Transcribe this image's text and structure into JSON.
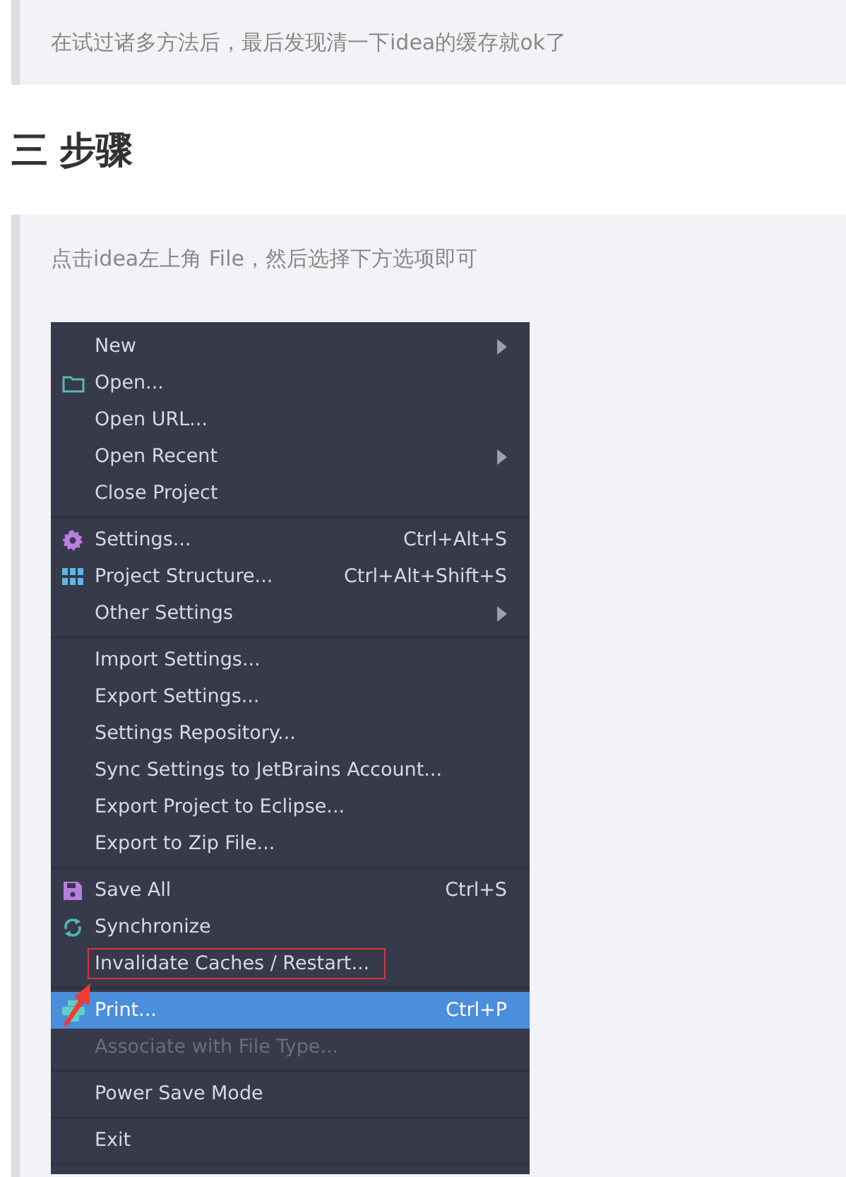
{
  "notes": [
    {
      "text": "在试过诸多方法后，最后发现清一下idea的缓存就ok了"
    }
  ],
  "heading": {
    "number": "三",
    "title": "步骤"
  },
  "step": {
    "text": "点击idea左上角 File，然后选择下方选项即可",
    "menu": {
      "groups": [
        [
          {
            "kind": "plain",
            "label": "New",
            "submenu": true,
            "selected": false,
            "disabled": false,
            "boxed": false
          },
          {
            "kind": "folder",
            "label": "Open...",
            "submenu": false,
            "selected": false,
            "disabled": false,
            "boxed": false
          },
          {
            "kind": "plain",
            "label": "Open URL...",
            "submenu": false,
            "selected": false,
            "disabled": false,
            "boxed": false
          },
          {
            "kind": "plain",
            "label": "Open Recent",
            "submenu": true,
            "selected": false,
            "disabled": false,
            "boxed": false
          },
          {
            "kind": "plain",
            "label": "Close Project",
            "submenu": false,
            "selected": false,
            "disabled": false,
            "boxed": false
          }
        ],
        [
          {
            "kind": "gear",
            "label": "Settings...",
            "shortcut": "Ctrl+Alt+S",
            "submenu": false,
            "selected": false,
            "disabled": false,
            "boxed": false
          },
          {
            "kind": "grid",
            "label": "Project Structure...",
            "shortcut": "Ctrl+Alt+Shift+S",
            "submenu": false,
            "selected": false,
            "disabled": false,
            "boxed": false
          },
          {
            "kind": "plain",
            "label": "Other Settings",
            "submenu": true,
            "selected": false,
            "disabled": false,
            "boxed": false
          }
        ],
        [
          {
            "kind": "plain",
            "label": "Import Settings...",
            "submenu": false,
            "selected": false,
            "disabled": false,
            "boxed": false
          },
          {
            "kind": "plain",
            "label": "Export Settings...",
            "submenu": false,
            "selected": false,
            "disabled": false,
            "boxed": false
          },
          {
            "kind": "plain",
            "label": "Settings Repository...",
            "submenu": false,
            "selected": false,
            "disabled": false,
            "boxed": false
          },
          {
            "kind": "plain",
            "label": "Sync Settings to JetBrains Account...",
            "submenu": false,
            "selected": false,
            "disabled": false,
            "boxed": false
          },
          {
            "kind": "plain",
            "label": "Export Project to Eclipse...",
            "submenu": false,
            "selected": false,
            "disabled": false,
            "boxed": false
          },
          {
            "kind": "plain",
            "label": "Export to Zip File...",
            "submenu": false,
            "selected": false,
            "disabled": false,
            "boxed": false
          }
        ],
        [
          {
            "kind": "save",
            "label": "Save All",
            "shortcut": "Ctrl+S",
            "submenu": false,
            "selected": false,
            "disabled": false,
            "boxed": false
          },
          {
            "kind": "sync",
            "label": "Synchronize",
            "submenu": false,
            "selected": false,
            "disabled": false,
            "boxed": false
          },
          {
            "kind": "plain",
            "label": "Invalidate Caches / Restart...",
            "submenu": false,
            "selected": false,
            "disabled": false,
            "boxed": true
          }
        ],
        [
          {
            "kind": "print",
            "label": "Print...",
            "shortcut": "Ctrl+P",
            "submenu": false,
            "selected": true,
            "disabled": false,
            "boxed": false
          },
          {
            "kind": "plain",
            "label": "Associate with File Type...",
            "submenu": false,
            "selected": false,
            "disabled": true,
            "boxed": false
          }
        ],
        [
          {
            "kind": "plain",
            "label": "Power Save Mode",
            "submenu": false,
            "selected": false,
            "disabled": false,
            "boxed": false
          }
        ],
        [
          {
            "kind": "plain",
            "label": "Exit",
            "submenu": false,
            "selected": false,
            "disabled": false,
            "boxed": false
          }
        ]
      ]
    }
  }
}
